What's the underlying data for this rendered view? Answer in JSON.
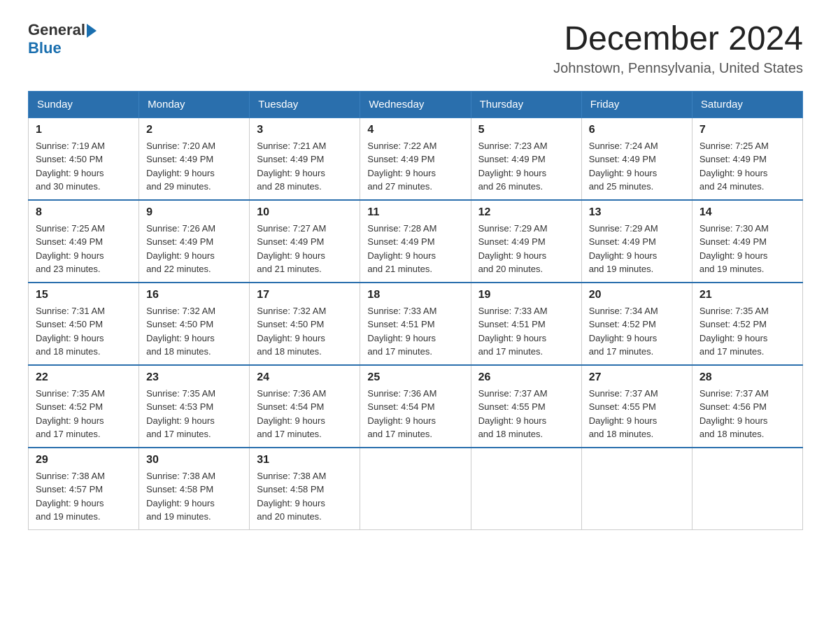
{
  "header": {
    "logo_general": "General",
    "logo_blue": "Blue",
    "title": "December 2024",
    "subtitle": "Johnstown, Pennsylvania, United States"
  },
  "weekdays": [
    "Sunday",
    "Monday",
    "Tuesday",
    "Wednesday",
    "Thursday",
    "Friday",
    "Saturday"
  ],
  "weeks": [
    [
      {
        "day": "1",
        "sunrise": "7:19 AM",
        "sunset": "4:50 PM",
        "daylight": "9 hours and 30 minutes."
      },
      {
        "day": "2",
        "sunrise": "7:20 AM",
        "sunset": "4:49 PM",
        "daylight": "9 hours and 29 minutes."
      },
      {
        "day": "3",
        "sunrise": "7:21 AM",
        "sunset": "4:49 PM",
        "daylight": "9 hours and 28 minutes."
      },
      {
        "day": "4",
        "sunrise": "7:22 AM",
        "sunset": "4:49 PM",
        "daylight": "9 hours and 27 minutes."
      },
      {
        "day": "5",
        "sunrise": "7:23 AM",
        "sunset": "4:49 PM",
        "daylight": "9 hours and 26 minutes."
      },
      {
        "day": "6",
        "sunrise": "7:24 AM",
        "sunset": "4:49 PM",
        "daylight": "9 hours and 25 minutes."
      },
      {
        "day": "7",
        "sunrise": "7:25 AM",
        "sunset": "4:49 PM",
        "daylight": "9 hours and 24 minutes."
      }
    ],
    [
      {
        "day": "8",
        "sunrise": "7:25 AM",
        "sunset": "4:49 PM",
        "daylight": "9 hours and 23 minutes."
      },
      {
        "day": "9",
        "sunrise": "7:26 AM",
        "sunset": "4:49 PM",
        "daylight": "9 hours and 22 minutes."
      },
      {
        "day": "10",
        "sunrise": "7:27 AM",
        "sunset": "4:49 PM",
        "daylight": "9 hours and 21 minutes."
      },
      {
        "day": "11",
        "sunrise": "7:28 AM",
        "sunset": "4:49 PM",
        "daylight": "9 hours and 21 minutes."
      },
      {
        "day": "12",
        "sunrise": "7:29 AM",
        "sunset": "4:49 PM",
        "daylight": "9 hours and 20 minutes."
      },
      {
        "day": "13",
        "sunrise": "7:29 AM",
        "sunset": "4:49 PM",
        "daylight": "9 hours and 19 minutes."
      },
      {
        "day": "14",
        "sunrise": "7:30 AM",
        "sunset": "4:49 PM",
        "daylight": "9 hours and 19 minutes."
      }
    ],
    [
      {
        "day": "15",
        "sunrise": "7:31 AM",
        "sunset": "4:50 PM",
        "daylight": "9 hours and 18 minutes."
      },
      {
        "day": "16",
        "sunrise": "7:32 AM",
        "sunset": "4:50 PM",
        "daylight": "9 hours and 18 minutes."
      },
      {
        "day": "17",
        "sunrise": "7:32 AM",
        "sunset": "4:50 PM",
        "daylight": "9 hours and 18 minutes."
      },
      {
        "day": "18",
        "sunrise": "7:33 AM",
        "sunset": "4:51 PM",
        "daylight": "9 hours and 17 minutes."
      },
      {
        "day": "19",
        "sunrise": "7:33 AM",
        "sunset": "4:51 PM",
        "daylight": "9 hours and 17 minutes."
      },
      {
        "day": "20",
        "sunrise": "7:34 AM",
        "sunset": "4:52 PM",
        "daylight": "9 hours and 17 minutes."
      },
      {
        "day": "21",
        "sunrise": "7:35 AM",
        "sunset": "4:52 PM",
        "daylight": "9 hours and 17 minutes."
      }
    ],
    [
      {
        "day": "22",
        "sunrise": "7:35 AM",
        "sunset": "4:52 PM",
        "daylight": "9 hours and 17 minutes."
      },
      {
        "day": "23",
        "sunrise": "7:35 AM",
        "sunset": "4:53 PM",
        "daylight": "9 hours and 17 minutes."
      },
      {
        "day": "24",
        "sunrise": "7:36 AM",
        "sunset": "4:54 PM",
        "daylight": "9 hours and 17 minutes."
      },
      {
        "day": "25",
        "sunrise": "7:36 AM",
        "sunset": "4:54 PM",
        "daylight": "9 hours and 17 minutes."
      },
      {
        "day": "26",
        "sunrise": "7:37 AM",
        "sunset": "4:55 PM",
        "daylight": "9 hours and 18 minutes."
      },
      {
        "day": "27",
        "sunrise": "7:37 AM",
        "sunset": "4:55 PM",
        "daylight": "9 hours and 18 minutes."
      },
      {
        "day": "28",
        "sunrise": "7:37 AM",
        "sunset": "4:56 PM",
        "daylight": "9 hours and 18 minutes."
      }
    ],
    [
      {
        "day": "29",
        "sunrise": "7:38 AM",
        "sunset": "4:57 PM",
        "daylight": "9 hours and 19 minutes."
      },
      {
        "day": "30",
        "sunrise": "7:38 AM",
        "sunset": "4:58 PM",
        "daylight": "9 hours and 19 minutes."
      },
      {
        "day": "31",
        "sunrise": "7:38 AM",
        "sunset": "4:58 PM",
        "daylight": "9 hours and 20 minutes."
      },
      null,
      null,
      null,
      null
    ]
  ],
  "labels": {
    "sunrise": "Sunrise:",
    "sunset": "Sunset:",
    "daylight": "Daylight:"
  }
}
